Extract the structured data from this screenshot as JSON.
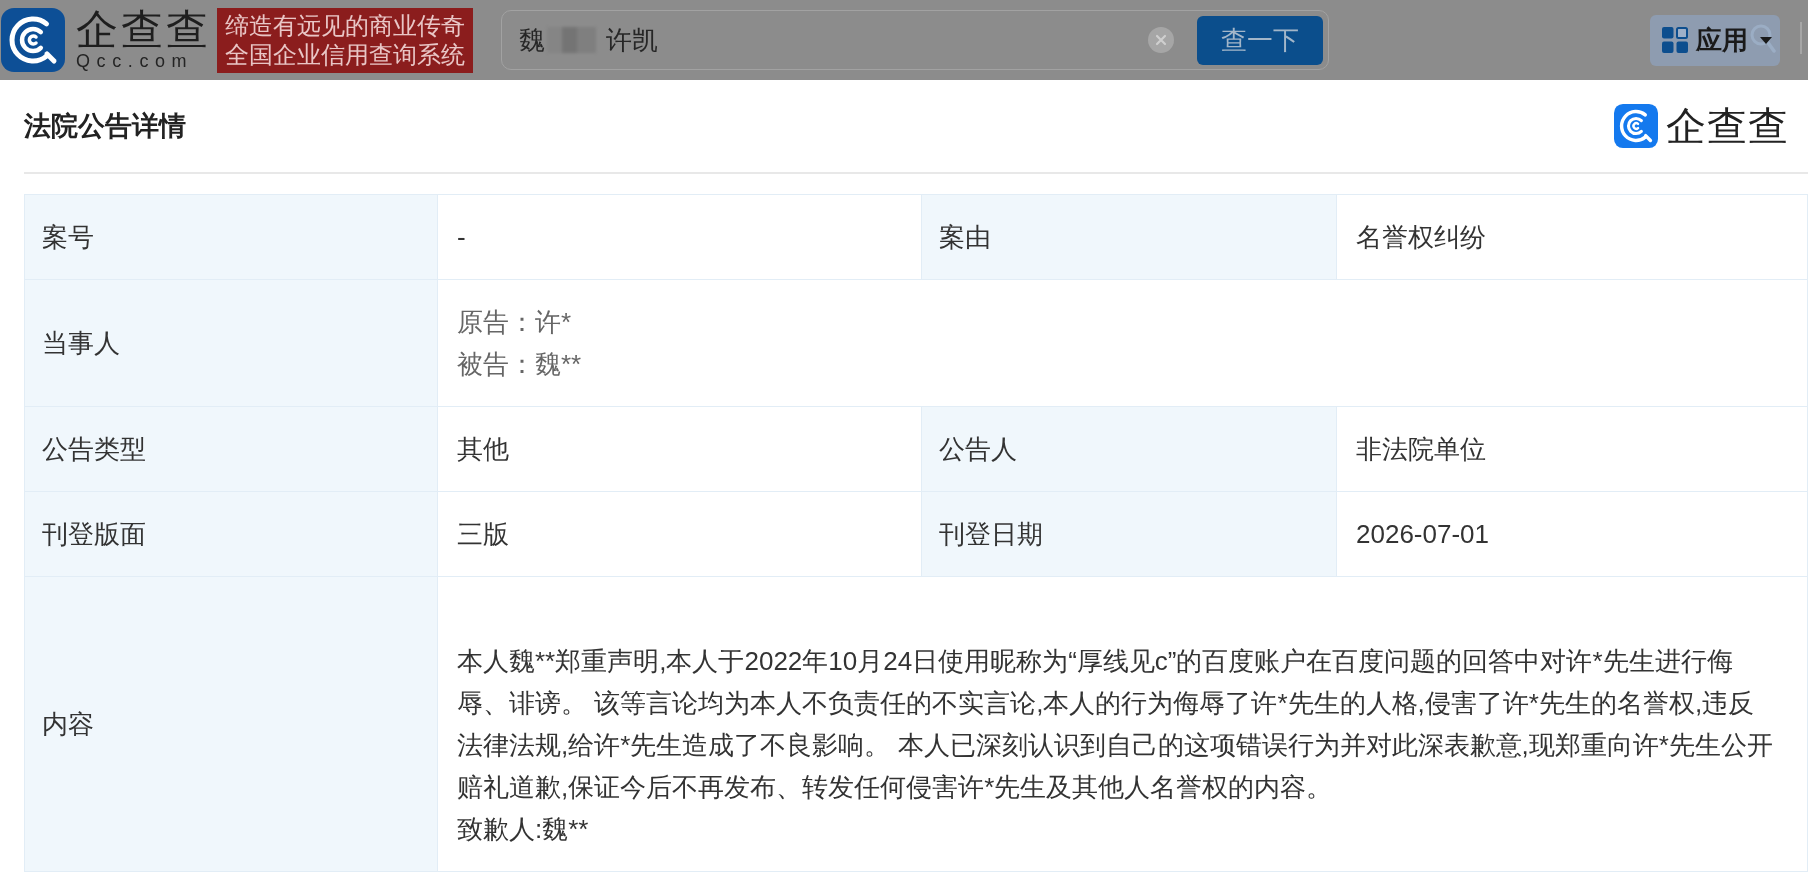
{
  "header": {
    "logo_text": "企查查",
    "logo_domain": "Qcc.com",
    "slogan_lines": [
      "缔造有远见的商业传奇",
      "全国企业信用查询系统"
    ],
    "search": {
      "value_before": "魏",
      "redacted": true,
      "value_after": "许凯"
    },
    "search_button": "查一下",
    "apps_button": "应用"
  },
  "dialog": {
    "title": "法院公告详情",
    "brand": "企查查",
    "table": {
      "rows": [
        {
          "kind": "pair",
          "fields": [
            {
              "label": "案号",
              "value": "-"
            },
            {
              "label": "案由",
              "value": "名誉权纠纷"
            }
          ]
        },
        {
          "kind": "lines",
          "label": "当事人",
          "lines": [
            "原告：许*",
            "被告：魏**"
          ]
        },
        {
          "kind": "pair",
          "fields": [
            {
              "label": "公告类型",
              "value": "其他"
            },
            {
              "label": "公告人",
              "value": "非法院单位"
            }
          ]
        },
        {
          "kind": "pair",
          "fields": [
            {
              "label": "刊登版面",
              "value": "三版"
            },
            {
              "label": "刊登日期",
              "value": "2026-07-01"
            }
          ]
        },
        {
          "kind": "text",
          "label": "内容",
          "paragraphs": [
            "本人魏**郑重声明,本人于2022年10月24日使用昵称为“厚线见c”的百度账户在百度问题的回答中对许*先生进行侮辱、诽谤。 该等言论均为本人不负责任的不实言论,本人的行为侮辱了许*先生的人格,侵害了许*先生的名誉权,违反法律法规,给许*先生造成了不良影响。 本人已深刻认识到自己的这项错误行为并对此深表歉意,现郑重向许*先生公开赔礼道歉,保证今后不再发布、转发任何侵害许*先生及其他人名誉权的内容。",
            "致歉人:魏**"
          ]
        }
      ]
    }
  }
}
